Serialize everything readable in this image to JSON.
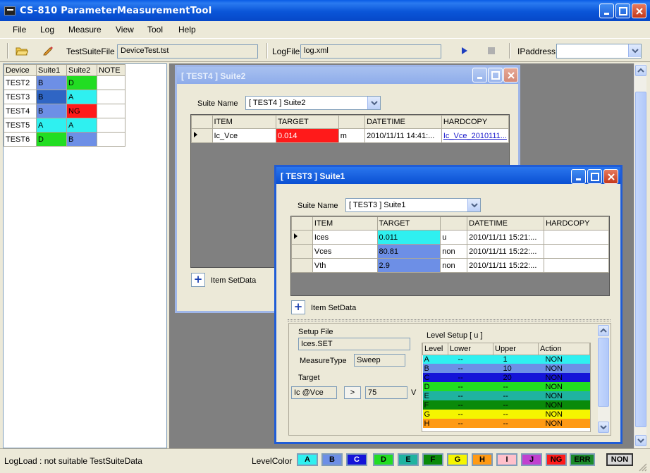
{
  "app": {
    "title": "CS-810 ParameterMeasurementTool"
  },
  "menu": [
    "File",
    "Log",
    "Measure",
    "View",
    "Tool",
    "Help"
  ],
  "toolbar": {
    "testsuite_label": "TestSuiteFile",
    "testsuite_value": "DeviceTest.tst",
    "logfile_label": "LogFile",
    "logfile_value": "log.xml",
    "ip_label": "IPaddress",
    "ip_value": ""
  },
  "device_table": {
    "headers": [
      "Device",
      "Suite1",
      "Suite2",
      "NOTE"
    ],
    "rows": [
      {
        "device": "TEST2",
        "suite1": "B",
        "suite2": "D",
        "note": "",
        "c1": "#6d8fe6",
        "c2": "#22dd22"
      },
      {
        "device": "TEST3",
        "suite1": "B",
        "suite2": "A",
        "note": "",
        "c1": "#2f65c4",
        "c2": "#2ff0f0"
      },
      {
        "device": "TEST4",
        "suite1": "B",
        "suite2": "NG",
        "note": "",
        "c1": "#6d8fe6",
        "c2": "#ff1a1a"
      },
      {
        "device": "TEST5",
        "suite1": "A",
        "suite2": "A",
        "note": "",
        "c1": "#2ff0f0",
        "c2": "#2ff0f0"
      },
      {
        "device": "TEST6",
        "suite1": "D",
        "suite2": "B",
        "note": "",
        "c1": "#22dd22",
        "c2": "#6d8fe6"
      }
    ]
  },
  "suite2_window": {
    "title": "[ TEST4 ] Suite2",
    "suite_name_label": "Suite Name",
    "suite_name_value": "[ TEST4 ] Suite2",
    "headers": [
      "ITEM",
      "TARGET",
      "",
      "DATETIME",
      "HARDCOPY"
    ],
    "rows": [
      {
        "item": "Ic_Vce",
        "target": "0.014",
        "unit": "m",
        "datetime": "2010/11/11 14:41:...",
        "hardcopy": "Ic_Vce_2010111...",
        "color": "#ff1a1a"
      }
    ],
    "add_label": "Item SetData"
  },
  "suite1_window": {
    "title": "[ TEST3 ] Suite1",
    "suite_name_label": "Suite Name",
    "suite_name_value": "[ TEST3 ] Suite1",
    "headers": [
      "ITEM",
      "TARGET",
      "",
      "DATETIME",
      "HARDCOPY"
    ],
    "rows": [
      {
        "item": "Ices",
        "target": "0.011",
        "unit": "u",
        "datetime": "2010/11/11 15:21:...",
        "hardcopy": "",
        "color": "#2ff0f0"
      },
      {
        "item": "Vces",
        "target": "80.81",
        "unit": "non",
        "datetime": "2010/11/11 15:22:...",
        "hardcopy": "",
        "color": "#6d8fe6"
      },
      {
        "item": "Vth",
        "target": "2.9",
        "unit": "non",
        "datetime": "2010/11/11 15:22:...",
        "hardcopy": "",
        "color": "#6d8fe6"
      }
    ],
    "add_label": "Item SetData",
    "setup": {
      "file_label": "Setup File",
      "file_value": "Ices.SET",
      "mtype_label": "MeasureType",
      "mtype_value": "Sweep",
      "target_label": "Target",
      "target_value": "Ic  @Vce",
      "compare": ">",
      "threshold": "75",
      "unit": "V"
    },
    "level_setup": {
      "title": "Level Setup [ u ]",
      "headers": [
        "Level",
        "Lower",
        "Upper",
        "Action"
      ],
      "rows": [
        {
          "level": "A",
          "lower": "--",
          "upper": "1",
          "action": "NON",
          "color": "#2ff0f0"
        },
        {
          "level": "B",
          "lower": "--",
          "upper": "10",
          "action": "NON",
          "color": "#6d8fe6"
        },
        {
          "level": "C",
          "lower": "--",
          "upper": "20",
          "action": "NON",
          "color": "#1414d8"
        },
        {
          "level": "D",
          "lower": "--",
          "upper": "--",
          "action": "NON",
          "color": "#22dd22"
        },
        {
          "level": "E",
          "lower": "--",
          "upper": "--",
          "action": "NON",
          "color": "#1fb3a0"
        },
        {
          "level": "F",
          "lower": "--",
          "upper": "--",
          "action": "NON",
          "color": "#0a8a0a"
        },
        {
          "level": "G",
          "lower": "--",
          "upper": "--",
          "action": "NON",
          "color": "#f5f500"
        },
        {
          "level": "H",
          "lower": "--",
          "upper": "--",
          "action": "NON",
          "color": "#ff9a14"
        }
      ]
    }
  },
  "status": {
    "message": "LogLoad : not suitable TestSuiteData",
    "level_label": "LevelColor",
    "levels": [
      {
        "label": "A",
        "color": "#2ff0f0"
      },
      {
        "label": "B",
        "color": "#6d8fe6"
      },
      {
        "label": "C",
        "color": "#1414d8"
      },
      {
        "label": "D",
        "color": "#22dd22"
      },
      {
        "label": "E",
        "color": "#1fb3a0"
      },
      {
        "label": "F",
        "color": "#0a8a0a"
      },
      {
        "label": "G",
        "color": "#f5f500"
      },
      {
        "label": "H",
        "color": "#ff9a14"
      },
      {
        "label": "I",
        "color": "#ffc0cb"
      },
      {
        "label": "J",
        "color": "#c040d0"
      },
      {
        "label": "NG",
        "color": "#ff1a1a"
      },
      {
        "label": "ERR",
        "color": "#1a8a2a"
      },
      {
        "label": "NON",
        "color": "#d8d8d8"
      }
    ]
  }
}
